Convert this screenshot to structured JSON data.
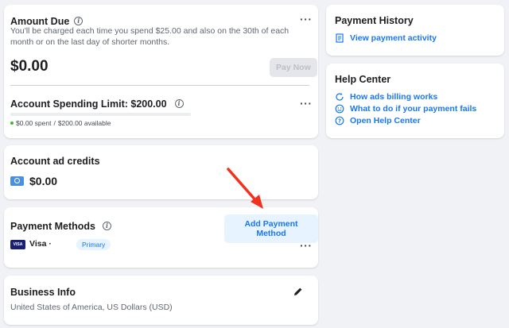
{
  "amount_due": {
    "title": "Amount Due",
    "description": "You'll be charged each time you spend $25.00 and also on the 30th of each month or on the last day of shorter months.",
    "value": "$0.00",
    "pay_now_label": "Pay Now"
  },
  "spending_limit": {
    "title": "Account Spending Limit: $200.00",
    "spent": "$0.00 spent",
    "available": "$200.00 available",
    "progress_fraction": 0.0,
    "dot_color": "#42b72a"
  },
  "ad_credits": {
    "title": "Account ad credits",
    "value": "$0.00"
  },
  "payment_methods": {
    "title": "Payment Methods",
    "add_label": "Add Payment Method",
    "items": [
      {
        "brand": "VISA",
        "label": "Visa ·",
        "badge": "Primary"
      }
    ]
  },
  "business_info": {
    "title": "Business Info",
    "value": "United States of America, US Dollars (USD)"
  },
  "payment_history": {
    "title": "Payment History",
    "link": "View payment activity"
  },
  "help_center": {
    "title": "Help Center",
    "links": [
      "How ads billing works",
      "What to do if your payment fails",
      "Open Help Center"
    ]
  },
  "annotation": {
    "arrow_color": "#f0321e"
  }
}
